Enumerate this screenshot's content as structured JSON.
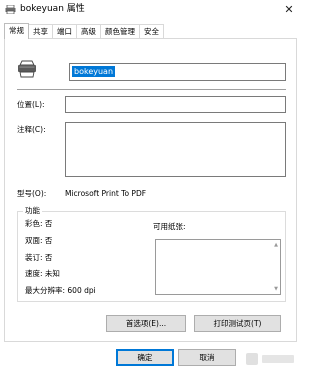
{
  "window": {
    "title": "bokeyuan 属性",
    "close_glyph": "✕"
  },
  "tabs": [
    {
      "label": "常规",
      "active": true
    },
    {
      "label": "共享"
    },
    {
      "label": "端口"
    },
    {
      "label": "高级"
    },
    {
      "label": "颜色管理"
    },
    {
      "label": "安全"
    }
  ],
  "general": {
    "printer_name": "bokeyuan",
    "location_label": "位置(L):",
    "location_value": "",
    "comment_label": "注释(C):",
    "comment_value": "",
    "model_label": "型号(O):",
    "model_value": "Microsoft Print To PDF",
    "features": {
      "title": "功能",
      "color": "彩色: 否",
      "duplex": "双面: 否",
      "staple": "装订: 否",
      "speed": "速度: 未知",
      "max_resolution": "最大分辨率: 600 dpi",
      "paper_label": "可用纸张:"
    },
    "preferences_button": "首选项(E)...",
    "print_test_button": "打印测试页(T)"
  },
  "footer": {
    "ok": "确定",
    "cancel": "取消"
  },
  "icons": [
    "printer-icon",
    "close-icon"
  ],
  "colors": {
    "selection": "#0078d7",
    "button_bg": "#e1e1e1"
  }
}
